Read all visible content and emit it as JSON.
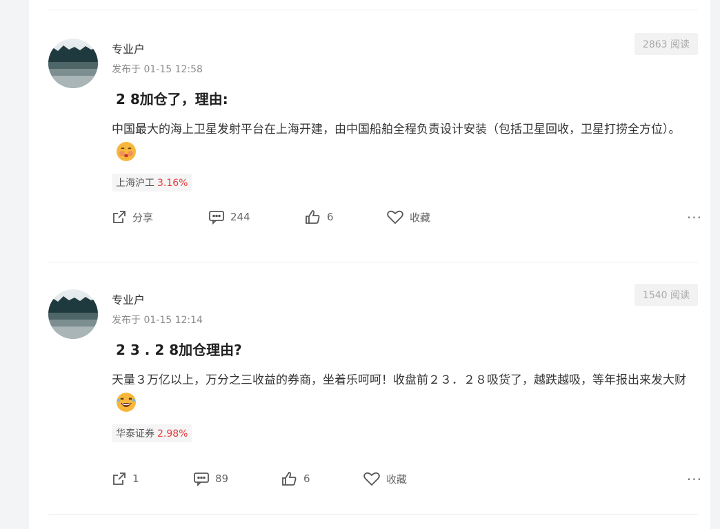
{
  "posts": [
    {
      "username": "专业户",
      "time": "发布于 01-15 12:58",
      "reads": "2863 阅读",
      "title": "2 8加仓了，理由:",
      "body": "中国最大的海上卫星发射平台在上海开建，由中国船舶全程负责设计安装（包括卫星回收，卫星打捞全方位）。",
      "emoji": "smiling-face-with-blush-emoji",
      "tag_name": "上海沪工",
      "tag_pct": "3.16%",
      "share": "分享",
      "comments": "244",
      "likes": "6",
      "favorite": "收藏",
      "more": "···"
    },
    {
      "username": "专业户",
      "time": "发布于 01-15 12:14",
      "reads": "1540 阅读",
      "title": "2 3 . 2 8加仓理由?",
      "body": "天量３万亿以上，万分之三收益的券商，坐着乐呵呵！收盘前２３．２８吸货了，越跌越吸，等年报出来发大财",
      "emoji": "laughing-face-emoji",
      "tag_name": "华泰证券",
      "tag_pct": "2.98%",
      "share": "1",
      "comments": "89",
      "likes": "6",
      "favorite": "收藏",
      "more": "···"
    }
  ],
  "colors": {
    "accent_red": "#e63b3b",
    "muted": "#8c8c8c",
    "background": "#f3f4f6"
  }
}
